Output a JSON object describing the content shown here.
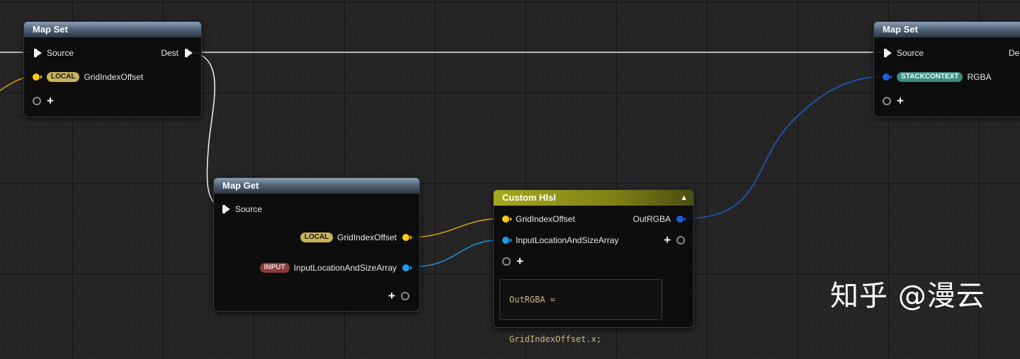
{
  "nodes": {
    "map_set_left": {
      "title": "Map Set",
      "source_label": "Source",
      "dest_label": "Dest",
      "key_badge": "LOCAL",
      "key_label": "GridIndexOffset",
      "add_pin_label": "+"
    },
    "map_set_right": {
      "title": "Map Set",
      "source_label": "Source",
      "dest_label": "Des",
      "key_badge": "STACKCONTEXT",
      "key_label": "RGBA",
      "add_pin_label": "+"
    },
    "map_get": {
      "title": "Map Get",
      "source_label": "Source",
      "out1_badge": "LOCAL",
      "out1_label": "GridIndexOffset",
      "out2_badge": "INPUT",
      "out2_label": "InputLocationAndSizeArray",
      "add_pin_label": "+"
    },
    "custom_hlsl": {
      "title": "Custom Hlsl",
      "collapse_glyph": "▲",
      "in1_label": "GridIndexOffset",
      "in2_label": "InputLocationAndSizeArray",
      "out1_label": "OutRGBA",
      "add_output_label": "+",
      "add_input_label": "+",
      "code": "OutRGBA = GridIndexOffset.x;"
    }
  },
  "watermark": "知乎 @漫云",
  "colors": {
    "exec_wire": "#e8e8e8",
    "float_wire": "#e0a81a",
    "vector_wire": "#1e9be8",
    "rgba_wire": "#1f5fd8"
  }
}
